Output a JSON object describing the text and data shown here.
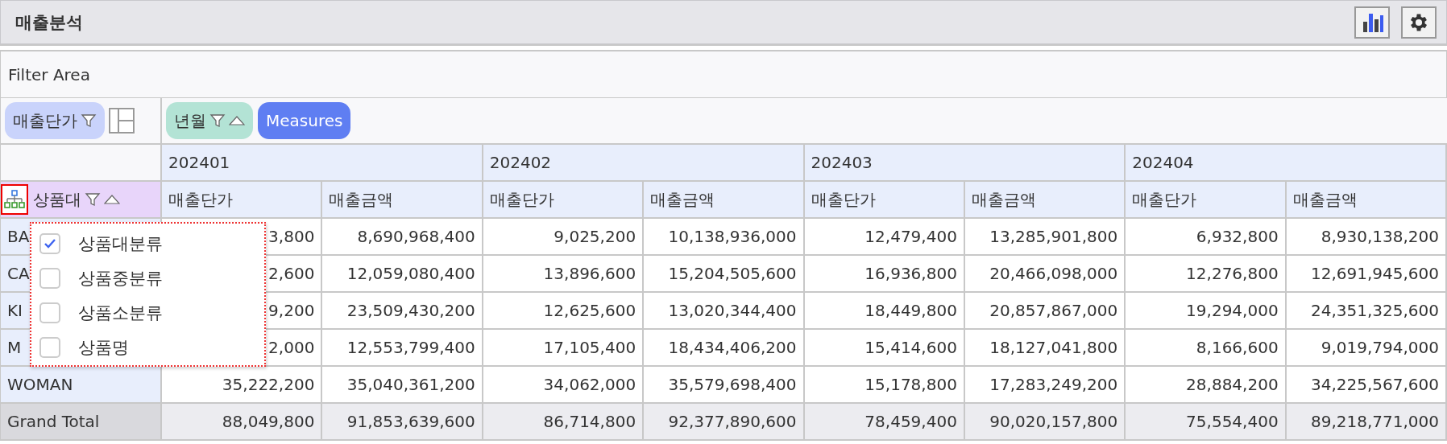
{
  "title": "매출분석",
  "filter_area": {
    "label": "Filter Area"
  },
  "row_fields": [
    {
      "label": "매출단가",
      "kind": "value",
      "filter": true,
      "sort": false
    }
  ],
  "column_fields": [
    {
      "label": "년월",
      "kind": "dimension",
      "filter": true,
      "sort": true
    },
    {
      "label": "Measures",
      "kind": "measures",
      "filter": false,
      "sort": false
    }
  ],
  "table": {
    "column_groups": [
      "202401",
      "202402",
      "202403",
      "202404"
    ],
    "measures": [
      "매출단가",
      "매출금액",
      "매출단가",
      "매출금액",
      "매출단가",
      "매출금액",
      "매출단가",
      "매출금액"
    ],
    "row_header": {
      "label": "상품대",
      "filter": true,
      "sort": true
    },
    "rows": [
      {
        "label": "BA",
        "cells": [
          "3,800",
          "8,690,968,400",
          "9,025,200",
          "10,138,936,000",
          "12,479,400",
          "13,285,901,800",
          "6,932,800",
          "8,930,138,200"
        ]
      },
      {
        "label": "CA",
        "cells": [
          "2,600",
          "12,059,080,400",
          "13,896,600",
          "15,204,505,600",
          "16,936,800",
          "20,466,098,000",
          "12,276,800",
          "12,691,945,600"
        ]
      },
      {
        "label": "KI",
        "cells": [
          "9,200",
          "23,509,430,200",
          "12,625,600",
          "13,020,344,400",
          "18,449,800",
          "20,857,867,000",
          "19,294,000",
          "24,351,325,600"
        ]
      },
      {
        "label": "M",
        "cells": [
          "2,000",
          "12,553,799,400",
          "17,105,400",
          "18,434,406,200",
          "15,414,600",
          "18,127,041,800",
          "8,166,600",
          "9,019,794,000"
        ]
      },
      {
        "label": "WOMAN",
        "cells": [
          "35,222,200",
          "35,040,361,200",
          "34,062,000",
          "35,579,698,400",
          "15,178,800",
          "17,283,249,200",
          "28,884,200",
          "34,225,567,600"
        ]
      }
    ],
    "total": {
      "label": "Grand Total",
      "cells": [
        "88,049,800",
        "91,853,639,600",
        "86,714,800",
        "92,377,890,600",
        "78,459,400",
        "90,020,157,800",
        "75,554,400",
        "89,218,771,000"
      ]
    }
  },
  "popup": {
    "items": [
      {
        "label": "상품대분류",
        "checked": true
      },
      {
        "label": "상품중분류",
        "checked": false
      },
      {
        "label": "상품소분류",
        "checked": false
      },
      {
        "label": "상품명",
        "checked": false
      }
    ]
  }
}
